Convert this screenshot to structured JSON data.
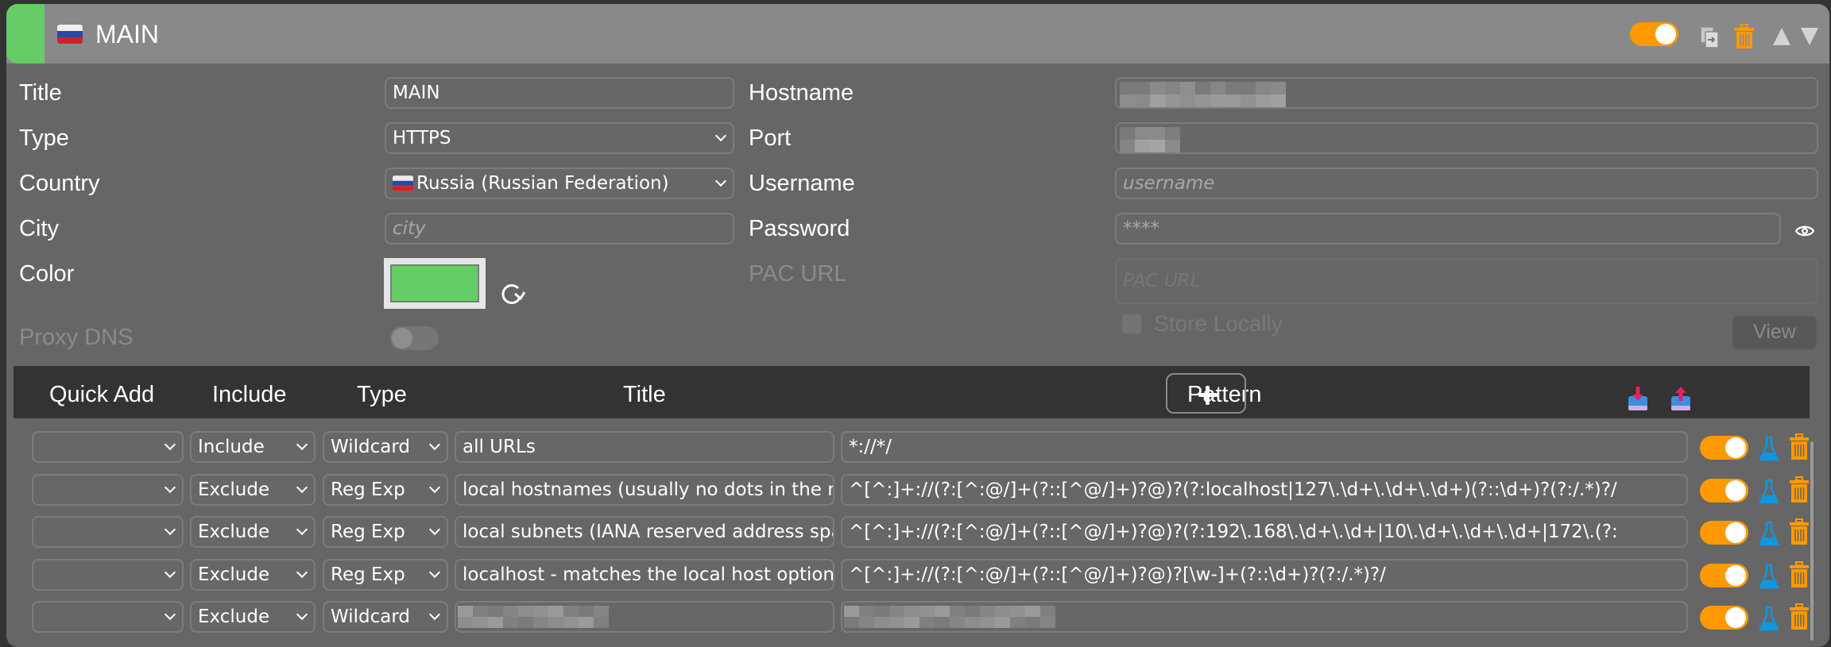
{
  "proxy": {
    "header_title": "MAIN",
    "color_hex": "#66cc66",
    "enabled": true,
    "flag_icon": "flag-russia-icon",
    "header_icons": [
      "toggle-switch",
      "duplicate-icon",
      "trash-icon",
      "move-up-icon",
      "move-down-icon"
    ]
  },
  "form": {
    "title": {
      "label": "Title",
      "value": "MAIN"
    },
    "type": {
      "label": "Type",
      "value": "HTTPS"
    },
    "country": {
      "label": "Country",
      "value": "Russia (Russian Federation)"
    },
    "city": {
      "label": "City",
      "placeholder": "city"
    },
    "color": {
      "label": "Color",
      "value": "#66cc66"
    },
    "proxy_dns": {
      "label": "Proxy DNS",
      "enabled": false
    },
    "hostname": {
      "label": "Hostname",
      "value_redacted": true
    },
    "port": {
      "label": "Port",
      "value_redacted": true
    },
    "username": {
      "label": "Username",
      "placeholder": "username"
    },
    "password": {
      "label": "Password",
      "placeholder": "****"
    },
    "pac_url": {
      "label": "PAC URL",
      "placeholder": "PAC URL"
    },
    "store_locally": {
      "label": "Store Locally",
      "checked": false
    },
    "view_button": "View"
  },
  "patterns": {
    "columns": [
      "Quick Add",
      "Include",
      "Type",
      "Title",
      "Pattern"
    ],
    "rows": [
      {
        "quick_add": "",
        "include": "Include",
        "type": "Wildcard",
        "title": "all URLs",
        "pattern": "*://*/",
        "enabled": true
      },
      {
        "quick_add": "",
        "include": "Exclude",
        "type": "Reg Exp",
        "title": "local hostnames (usually no dots in the name)",
        "pattern": "^[^:]+://(?:[^:@/]+(?::[^@/]+)?@)?(?:localhost|127\\.\\d+\\.\\d+\\.\\d+)(?::\\d+)?(?:/.*)?/",
        "enabled": true
      },
      {
        "quick_add": "",
        "include": "Exclude",
        "type": "Reg Exp",
        "title": "local subnets (IANA reserved address space)",
        "pattern": "^[^:]+://(?:[^:@/]+(?::[^@/]+)?@)?(?:192\\.168\\.\\d+\\.\\d+|10\\.\\d+\\.\\d+\\.\\d+|172\\.(?:",
        "enabled": true
      },
      {
        "quick_add": "",
        "include": "Exclude",
        "type": "Reg Exp",
        "title": "localhost - matches the local host optionally prefixed",
        "pattern": "^[^:]+://(?:[^:@/]+(?::[^@/]+)?@)?[\\w-]+(?::\\d+)?(?:/.*)?/",
        "enabled": true
      },
      {
        "quick_add": "",
        "include": "Exclude",
        "type": "Wildcard",
        "title": "",
        "pattern": "",
        "redacted": true,
        "enabled": true
      }
    ]
  },
  "colors": {
    "accent": "#ff9900",
    "flask": "#0f96e0",
    "card_bg": "#666666",
    "header_bg": "#898989",
    "table_header_bg": "#333333"
  }
}
